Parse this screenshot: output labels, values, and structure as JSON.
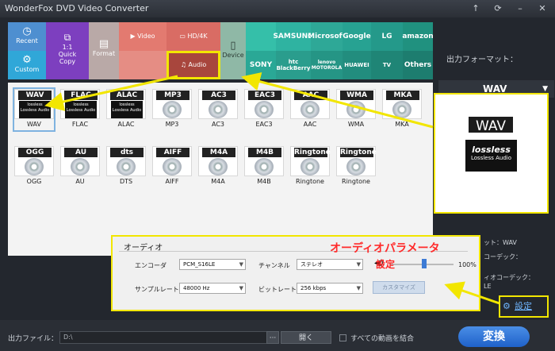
{
  "app": {
    "title": "WonderFox DVD Video Converter"
  },
  "categories": [
    {
      "label": "Recent",
      "icon": "clock-icon"
    },
    {
      "label": "Custom",
      "icon": "gear-icon"
    },
    {
      "label": "1:1\nQuick\nCopy",
      "icon": "copy-icon"
    },
    {
      "label": "Format",
      "icon": "document-icon"
    },
    {
      "label": "Video",
      "icon": "play-icon"
    },
    {
      "label": "HD/4K",
      "icon": "hd-icon"
    },
    {
      "label": "Audio",
      "icon": "headphones-icon"
    },
    {
      "label": "Device",
      "icon": "phone-icon"
    }
  ],
  "brands_top": [
    "SAMSUNG",
    "Microsoft",
    "Google",
    "LG",
    "amazon"
  ],
  "brands_bottom": [
    "SONY",
    "htc BlackBerry",
    "lenovo MOTOROLA",
    "HUAWEI",
    "TV",
    "Others"
  ],
  "formats_row1": [
    {
      "tag": "WAV",
      "name": "WAV",
      "lossless": true
    },
    {
      "tag": "FLAC",
      "name": "FLAC",
      "lossless": true
    },
    {
      "tag": "ALAC",
      "name": "ALAC",
      "lossless": true
    },
    {
      "tag": "MP3",
      "name": "MP3"
    },
    {
      "tag": "AC3",
      "name": "AC3"
    },
    {
      "tag": "EAC3",
      "name": "EAC3"
    },
    {
      "tag": "AAC",
      "name": "AAC"
    },
    {
      "tag": "WMA",
      "name": "WMA"
    },
    {
      "tag": "MKA",
      "name": "MKA"
    }
  ],
  "formats_row2": [
    {
      "tag": "OGG",
      "name": "OGG"
    },
    {
      "tag": "AU",
      "name": "AU"
    },
    {
      "tag": "dts",
      "name": "DTS"
    },
    {
      "tag": "AIFF",
      "name": "AIFF"
    },
    {
      "tag": "M4A",
      "name": "M4A"
    },
    {
      "tag": "M4B",
      "name": "M4B"
    },
    {
      "tag": "Ringtone",
      "name": "Ringtone"
    },
    {
      "tag": "Ringtone",
      "name": "Ringtone"
    }
  ],
  "output": {
    "format_label": "出力フォーマット：",
    "format_value": "WAV",
    "preview_tag": "WAV",
    "preview_lossless": "lossless",
    "preview_lossless_sub": "Lossless Audio",
    "side1": "ット：WAV",
    "side2": "コーデック：",
    "side3": "ィオコーデック：",
    "side4": "LE",
    "settings_link": "設定"
  },
  "audio_settings": {
    "title": "オーディオ",
    "encoder_label": "エンコーダ",
    "encoder_value": "PCM_S16LE",
    "channel_label": "チャンネル",
    "channel_value": "ステレオ",
    "volume": "100%",
    "samplerate_label": "サンプルレート",
    "samplerate_value": "48000 Hz",
    "bitrate_label": "ビットレート",
    "bitrate_value": "256 kbps",
    "customize_label": "カスタマイズ"
  },
  "annotation": {
    "line1": "オーディオパラメータ",
    "line2": "設定"
  },
  "bottom": {
    "output_file_label": "出力ファイル：",
    "output_path": "D:\\",
    "browse": "···",
    "open": "開く",
    "merge_label": "すべての動画を結合",
    "convert": "変換"
  },
  "colors": {
    "highlight": "#f2e600",
    "accent": "#ff2a2a",
    "convert": "#2f74d8"
  }
}
